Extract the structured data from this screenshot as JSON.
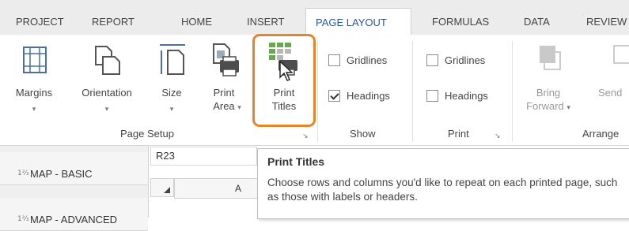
{
  "tabs": [
    {
      "label": "PROJECT"
    },
    {
      "label": "REPORT"
    },
    {
      "label": "HOME"
    },
    {
      "label": "INSERT"
    },
    {
      "label": "PAGE LAYOUT",
      "active": true
    },
    {
      "label": "FORMULAS"
    },
    {
      "label": "DATA"
    },
    {
      "label": "REVIEW"
    }
  ],
  "ribbon": {
    "margins": "Margins",
    "orientation": "Orientation",
    "size": "Size",
    "print_area_1": "Print",
    "print_area_2": "Area",
    "print_titles_1": "Print",
    "print_titles_2": "Titles",
    "group_page_setup": "Page Setup",
    "show_gridlines": "Gridlines",
    "show_headings": "Headings",
    "group_show": "Show",
    "print_gridlines": "Gridlines",
    "print_headings": "Headings",
    "group_print": "Print",
    "bring_1": "Bring",
    "bring_2": "Forward",
    "send": "Send",
    "group_arrange": "Arrange",
    "show_gridlines_checked": false,
    "show_headings_checked": true,
    "print_gridlines_checked": false,
    "print_headings_checked": false
  },
  "side_nav": [
    {
      "label": "MAP - BASIC"
    },
    {
      "label": "MAP - ADVANCED"
    }
  ],
  "namebox": "R23",
  "column_header": "A",
  "tooltip": {
    "title": "Print Titles",
    "body": "Choose rows and columns you'd like to repeat on each printed page, such as those with labels or headers."
  },
  "colors": {
    "accent": "#e5842a",
    "active_tab": "#2b5797"
  }
}
